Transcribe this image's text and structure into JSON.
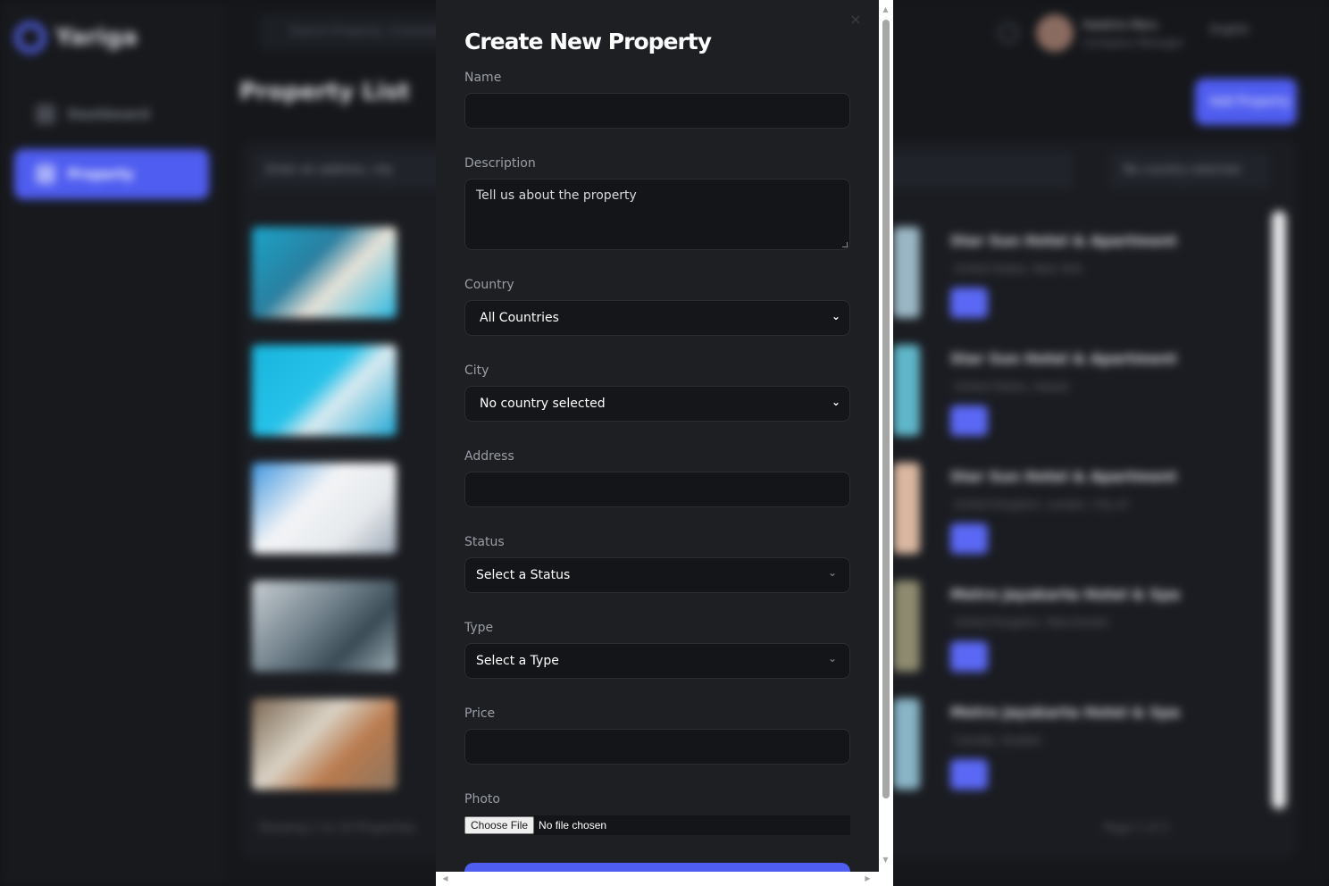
{
  "background": {
    "brand": "Yariga",
    "search_placeholder": "Search Property, Customer etc",
    "user_name": "Hawkins Maru",
    "user_role": "Company Manager",
    "language": "English",
    "nav": [
      "Dashboard",
      "Property"
    ],
    "page_title": "Property List",
    "add_button": "Add Property",
    "filter_search": "Enter an address, city",
    "filter_country": "No country selected",
    "cards": [
      {
        "title": "Star Sun Hotel & Apartment",
        "location": "United States, New York"
      },
      {
        "title": "Star Sun Hotel & Apartment",
        "location": "United States, Hawaii"
      },
      {
        "title": "Star Sun Hotel & Apartment",
        "location": "United Kingdom, London, City of"
      },
      {
        "title": "Metro Jayakarta Hotel & Spa",
        "location": "United Kingdom, Manchester"
      },
      {
        "title": "Metro Jayakarta Hotel & Spa",
        "location": "Canada, Quebec"
      }
    ],
    "footer_left": "Showing 1 to 10 Properties",
    "footer_right": "Page 1 of 2"
  },
  "modal": {
    "title": "Create New Property",
    "close_symbol": "×",
    "fields": {
      "name_label": "Name",
      "name_value": "",
      "description_label": "Description",
      "description_placeholder": "Tell us about the property",
      "country_label": "Country",
      "country_value": "All Countries",
      "city_label": "City",
      "city_value": "No country selected",
      "address_label": "Address",
      "address_value": "",
      "status_label": "Status",
      "status_value": "Select a Status",
      "type_label": "Type",
      "type_value": "Select a Type",
      "price_label": "Price",
      "price_value": "",
      "photo_label": "Photo",
      "photo_button": "Choose File",
      "photo_status": "No file chosen"
    }
  },
  "colors": {
    "accent": "#4f5df0",
    "modal_bg": "#1d1f23",
    "input_bg": "#131518"
  }
}
